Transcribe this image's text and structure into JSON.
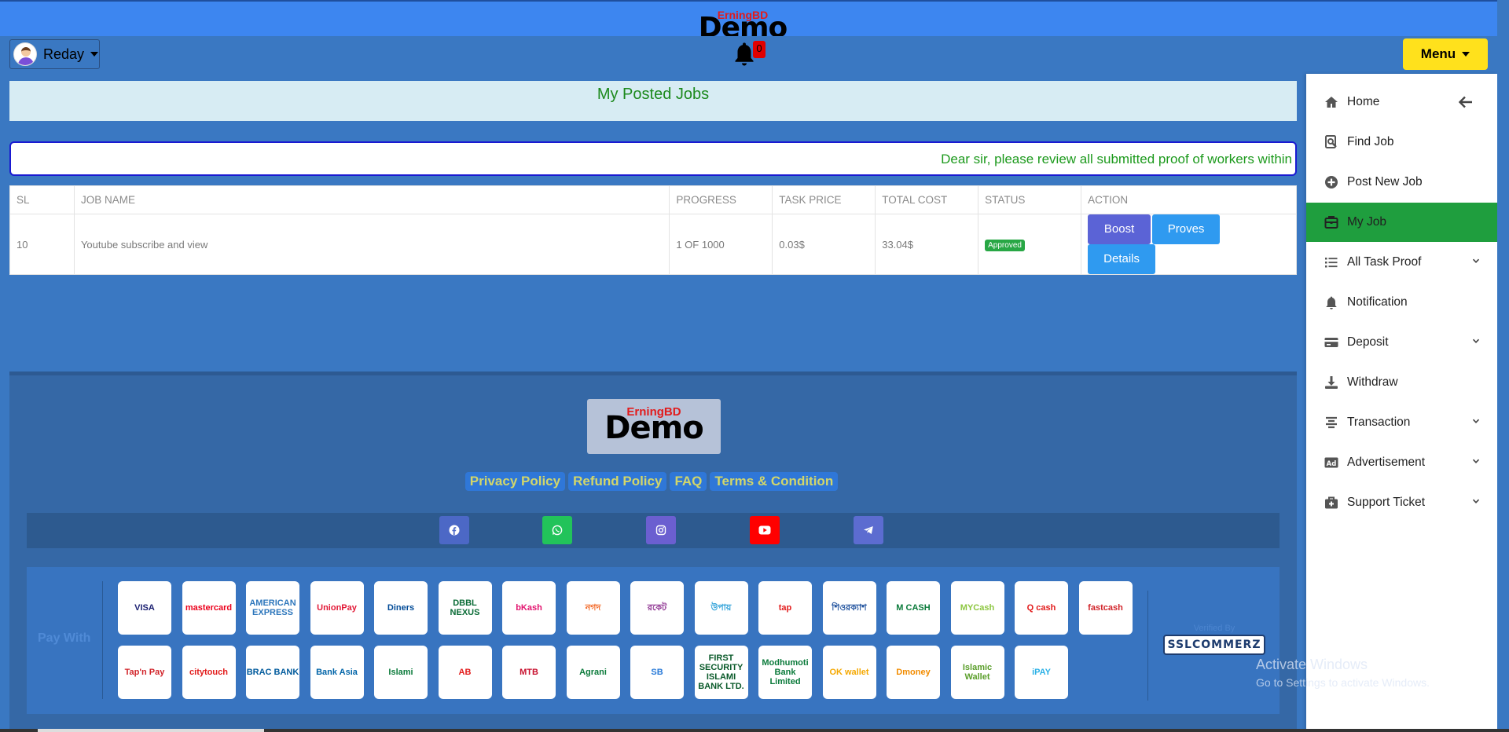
{
  "header": {
    "brand_small": "ErningBD",
    "brand_big": "Demo",
    "user_name": "Reday",
    "notification_count": "0",
    "menu_label": "Menu"
  },
  "page": {
    "title": "My Posted Jobs",
    "notice": "Dear sir, please review all submitted proof of workers within"
  },
  "table": {
    "headers": [
      "SL",
      "JOB NAME",
      "PROGRESS",
      "TASK PRICE",
      "TOTAL COST",
      "STATUS",
      "ACTION"
    ],
    "rows": [
      {
        "sl": "10",
        "job_name": "Youtube subscribe and view",
        "progress": "1 OF 1000",
        "task_price": "0.03$",
        "total_cost": "33.04$",
        "status": "Approved",
        "actions": {
          "boost": "Boost",
          "proves": "Proves",
          "details": "Details"
        }
      }
    ]
  },
  "footer": {
    "brand_small": "ErningBD",
    "brand_big": "Demo",
    "links": {
      "privacy": "Privacy Policy",
      "refund": "Refund Policy",
      "faq": "FAQ",
      "terms": "Terms & Condition"
    },
    "social": [
      "facebook-icon",
      "whatsapp-icon",
      "instagram-icon",
      "youtube-icon",
      "telegram-icon"
    ],
    "pay_with": "Pay With",
    "payment_row1": [
      "VISA",
      "mastercard",
      "AMERICAN EXPRESS",
      "UnionPay",
      "Diners",
      "DBBL NEXUS",
      "bKash",
      "নগদ",
      "রকেট",
      "উপায়",
      "tap",
      "শিওরক্যাশ",
      "M CASH",
      "MYCash",
      "Q cash",
      "fastcash"
    ],
    "payment_row2": [
      "Tap'n Pay",
      "citytouch",
      "BRAC BANK",
      "Bank Asia",
      "Islami",
      "AB",
      "MTB",
      "Agrani",
      "SB",
      "FIRST SECURITY ISLAMI BANK LTD.",
      "Modhumoti Bank Limited",
      "OK wallet",
      "Dmoney",
      "Islamic Wallet",
      "iPAY"
    ],
    "verified_by": "Verified By",
    "ssl": "SSLCOMMERZ"
  },
  "sidebar": {
    "items": [
      {
        "label": "Home",
        "icon": "home-icon",
        "has_chevron": false
      },
      {
        "label": "Find Job",
        "icon": "search-icon",
        "has_chevron": false
      },
      {
        "label": "Post New Job",
        "icon": "plus-circle-icon",
        "has_chevron": false
      },
      {
        "label": "My Job",
        "icon": "briefcase-icon",
        "has_chevron": false
      },
      {
        "label": "All Task Proof",
        "icon": "list-icon",
        "has_chevron": true
      },
      {
        "label": "Notification",
        "icon": "bell-icon",
        "has_chevron": false
      },
      {
        "label": "Deposit",
        "icon": "card-icon",
        "has_chevron": true
      },
      {
        "label": "Withdraw",
        "icon": "download-icon",
        "has_chevron": false
      },
      {
        "label": "Transaction",
        "icon": "align-icon",
        "has_chevron": true
      },
      {
        "label": "Advertisement",
        "icon": "ad-icon",
        "has_chevron": true
      },
      {
        "label": "Support Ticket",
        "icon": "medkit-icon",
        "has_chevron": true
      }
    ]
  },
  "watermark": {
    "line1": "Activate Windows",
    "line2": "Go to Settings to activate Windows."
  },
  "colors": {
    "accent_blue": "#3d86f0",
    "page_bg": "#3a78c2",
    "active_green": "#1f9e3e",
    "menu_yellow": "#ffe11c"
  }
}
